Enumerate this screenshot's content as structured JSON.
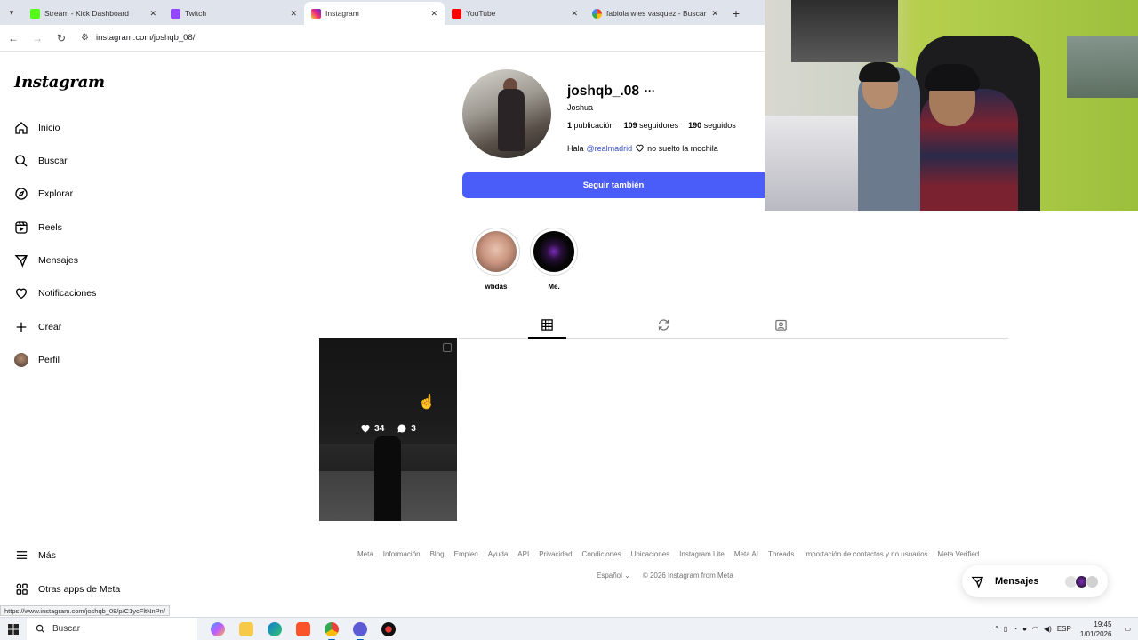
{
  "browser": {
    "tabs": [
      {
        "title": "Stream - Kick Dashboard",
        "favicon_color": "#53fc18",
        "active": false
      },
      {
        "title": "Twitch",
        "favicon_color": "#9146ff",
        "active": false
      },
      {
        "title": "Instagram",
        "favicon_color": "#d6249f",
        "active": true
      },
      {
        "title": "YouTube",
        "favicon_color": "#ff0000",
        "active": false
      },
      {
        "title": "fabiola wies vasquez - Buscar c",
        "favicon_color": "#4285f4",
        "active": false
      }
    ],
    "url": "instagram.com/joshqb_08/",
    "status_url": "https://www.instagram.com/joshqb_08/p/C1ycFltNnPn/"
  },
  "sidebar": {
    "logo": "Instagram",
    "items": [
      {
        "label": "Inicio",
        "icon": "home-icon"
      },
      {
        "label": "Buscar",
        "icon": "search-icon"
      },
      {
        "label": "Explorar",
        "icon": "compass-icon"
      },
      {
        "label": "Reels",
        "icon": "reels-icon"
      },
      {
        "label": "Mensajes",
        "icon": "messenger-icon"
      },
      {
        "label": "Notificaciones",
        "icon": "heart-icon"
      },
      {
        "label": "Crear",
        "icon": "plus-icon"
      },
      {
        "label": "Perfil",
        "icon": "avatar-icon"
      }
    ],
    "more": "Más",
    "meta_apps": "Otras apps de Meta"
  },
  "profile": {
    "username": "joshqb_.08",
    "full_name": "Joshua",
    "posts_count": "1",
    "posts_label": "publicación",
    "followers_count": "109",
    "followers_label": "seguidores",
    "following_count": "190",
    "following_label": "seguidos",
    "bio_prefix": "Hala",
    "bio_mention": "@realmadrid",
    "bio_suffix": "no suelto la mochila",
    "follow_button": "Seguir también"
  },
  "highlights": [
    {
      "label": "wbdas"
    },
    {
      "label": "Me."
    }
  ],
  "post": {
    "likes": "34",
    "comments": "3"
  },
  "footer": {
    "links": [
      "Meta",
      "Información",
      "Blog",
      "Empleo",
      "Ayuda",
      "API",
      "Privacidad",
      "Condiciones",
      "Ubicaciones",
      "Instagram Lite",
      "Meta AI",
      "Threads",
      "Importación de contactos y no usuarios",
      "Meta Verified"
    ],
    "language": "Español",
    "copyright": "© 2026 Instagram from Meta"
  },
  "messages_pill": {
    "label": "Mensajes"
  },
  "taskbar": {
    "search": "Buscar",
    "lang": "ESP",
    "time": "19:45",
    "date": "1/01/2026"
  },
  "colors": {
    "follow_button": "#4a5df9",
    "mention": "#3b53c4",
    "footer_text": "#737373"
  }
}
